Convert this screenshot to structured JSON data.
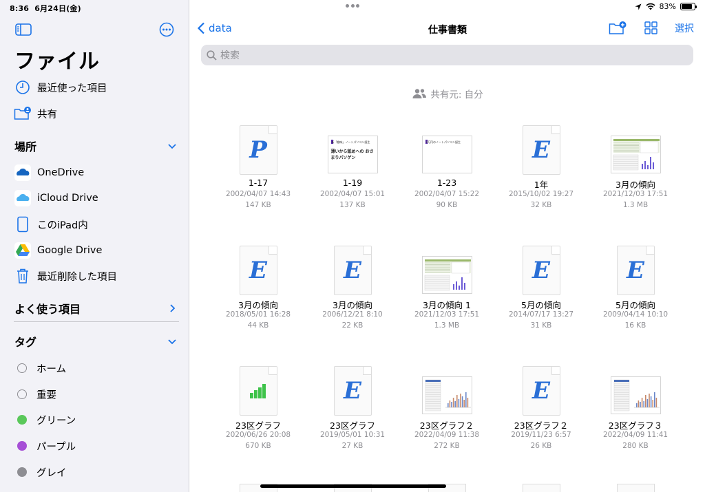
{
  "status": {
    "time": "8:36",
    "date": "6月24日(金)",
    "battery": "83%",
    "battery_level": 0.83
  },
  "sidebar": {
    "title": "ファイル",
    "top_items": [
      {
        "label": "最近使った項目",
        "icon": "clock-icon"
      },
      {
        "label": "共有",
        "icon": "shared-folder-icon"
      }
    ],
    "locations_header": "場所",
    "locations": [
      {
        "label": "OneDrive",
        "icon": "onedrive-icon"
      },
      {
        "label": "iCloud Drive",
        "icon": "icloud-icon"
      },
      {
        "label": "このiPad内",
        "icon": "ipad-icon"
      },
      {
        "label": "Google Drive",
        "icon": "google-drive-icon"
      },
      {
        "label": "最近削除した項目",
        "icon": "trash-icon"
      }
    ],
    "favorites_header": "よく使う項目",
    "tags_header": "タグ",
    "tags": [
      {
        "label": "ホーム",
        "color": ""
      },
      {
        "label": "重要",
        "color": ""
      },
      {
        "label": "グリーン",
        "color": "#5ac85a"
      },
      {
        "label": "パープル",
        "color": "#a64fd6"
      },
      {
        "label": "グレイ",
        "color": "#8e8e93"
      }
    ]
  },
  "nav": {
    "back_label": "data",
    "title": "仕事書類",
    "select_label": "選択"
  },
  "search": {
    "placeholder": "検索"
  },
  "shared_label": "共有元: 自分",
  "files": [
    {
      "name": "1-17",
      "date": "2002/04/07 14:43",
      "size": "147 KB",
      "thumb": "doc",
      "glyph": "P"
    },
    {
      "name": "1-19",
      "date": "2002/04/07 15:01",
      "size": "137 KB",
      "thumb": "slide",
      "slide_top": "新「趣味」ノートパソコン誕生",
      "slide_body": "薄いから舐めへの おさまりパソゲン"
    },
    {
      "name": "1-23",
      "date": "2002/04/07 15:22",
      "size": "90 KB",
      "thumb": "slide",
      "slide_top": "8万円のノートパソコン誕生",
      "slide_body": ""
    },
    {
      "name": "1年",
      "date": "2015/10/02 19:27",
      "size": "32 KB",
      "thumb": "doc",
      "glyph": "E"
    },
    {
      "name": "3月の傾向",
      "date": "2021/12/03 17:51",
      "size": "1.3 MB",
      "thumb": "sheet"
    },
    {
      "name": "3月の傾向",
      "date": "2018/05/01 16:28",
      "size": "44 KB",
      "thumb": "doc",
      "glyph": "E"
    },
    {
      "name": "3月の傾向",
      "date": "2006/12/21 8:10",
      "size": "22 KB",
      "thumb": "doc",
      "glyph": "E"
    },
    {
      "name": "3月の傾向 1",
      "date": "2021/12/03 17:51",
      "size": "1.3 MB",
      "thumb": "sheet"
    },
    {
      "name": "5月の傾向",
      "date": "2014/07/17 13:27",
      "size": "31 KB",
      "thumb": "doc",
      "glyph": "E"
    },
    {
      "name": "5月の傾向",
      "date": "2009/04/14 10:10",
      "size": "16 KB",
      "thumb": "doc",
      "glyph": "E"
    },
    {
      "name": "23区グラフ",
      "date": "2020/06/26 20:08",
      "size": "670 KB",
      "thumb": "numbers"
    },
    {
      "name": "23区グラフ",
      "date": "2019/05/01 10:31",
      "size": "27 KB",
      "thumb": "doc",
      "glyph": "E"
    },
    {
      "name": "23区グラフ２",
      "date": "2022/04/09 11:38",
      "size": "272 KB",
      "thumb": "chart"
    },
    {
      "name": "23区グラフ２",
      "date": "2019/11/23 6:57",
      "size": "26 KB",
      "thumb": "doc",
      "glyph": "E"
    },
    {
      "name": "23区グラフ３",
      "date": "2022/04/09 11:41",
      "size": "280 KB",
      "thumb": "chart"
    }
  ]
}
